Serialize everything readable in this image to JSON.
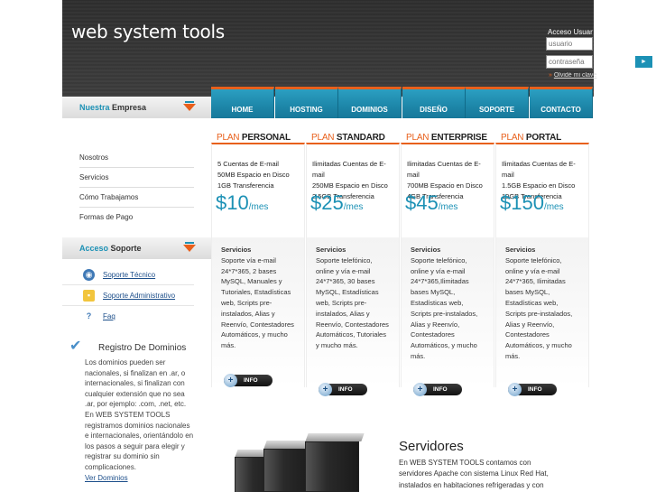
{
  "logo": "web system tools",
  "login": {
    "title": "Acceso Usuarios",
    "user_placeholder": "usuario",
    "pass_placeholder": "contraseña",
    "forgot_arrow": "»",
    "forgot": "Olvidé mi clave",
    "go_icon": "►"
  },
  "nav": [
    "HOME",
    "HOSTING",
    "DOMINIOS",
    "DISEÑO",
    "SOPORTE",
    "CONTACTO"
  ],
  "sidebar": {
    "empresa_title_blue": "Nuestra",
    "empresa_title_rest": " Empresa",
    "empresa_items": [
      "Nosotros",
      "Servicios",
      "Cómo Trabajamos",
      "Formas de Pago"
    ],
    "soporte_title_blue": "Acceso",
    "soporte_title_rest": " Soporte",
    "soporte_items": [
      "Soporte Técnico",
      "Soporte Administrativo",
      "Faq"
    ],
    "registro_title": "Registro De Dominios",
    "registro_body": "Los dominios pueden ser nacionales, si finalizan en .ar, o internacionales, si finalizan con cualquier extensión que no sea .ar, por ejemplo: .com, .net, etc. En WEB SYSTEM TOOLS registramos dominios nacionales e internacionales, orientándolo en los pasos a seguir para elegir y registrar su dominio sin complicaciones.",
    "registro_link": "Ver Dominios"
  },
  "plans": [
    {
      "prefix": "PLAN ",
      "name": "PERSONAL",
      "features": [
        "5 Cuentas de E-mail",
        "50MB Espacio en Disco",
        "1GB Transferencia"
      ],
      "price": "$10",
      "per": "/mes",
      "serv_title": "Servicios",
      "serv_body": "Soporte vía e-mail 24*7*365, 2 bases MySQL, Manuales y Tutoriales, Estadísticas web, Scripts pre-instalados, Alias y Reenvío, Contestadores Automáticos, y mucho más.",
      "info": "INFO"
    },
    {
      "prefix": "PLAN ",
      "name": "STANDARD",
      "features": [
        "Ilimitadas Cuentas de E-mail",
        "250MB Espacio en Disco",
        "2.5GB Transferencia"
      ],
      "price": "$25",
      "per": "/mes",
      "serv_title": "Servicios",
      "serv_body": "Soporte telefónico, online y vía e-mail 24*7*365, 30 bases MySQL, Estadísticas web, Scripts pre-instalados, Alias y Reenvío, Contestadores Automáticos, Tutoriales y mucho más.",
      "info": "INFO"
    },
    {
      "prefix": "PLAN ",
      "name": "ENTERPRISE",
      "features": [
        "Ilimitadas Cuentas de E-mail",
        "700MB Espacio en Disco",
        "4GB Transferencia"
      ],
      "price": "$45",
      "per": "/mes",
      "serv_title": "Servicios",
      "serv_body": "Soporte telefónico, online y vía e-mail 24*7*365,Ilimitadas bases MySQL, Estadísticas web, Scripts pre-instalados, Alias y Reenvío, Contestadores Automáticos, y mucho más.",
      "info": "INFO"
    },
    {
      "prefix": "PLAN ",
      "name": "PORTAL",
      "features": [
        "Ilimitadas Cuentas de E-mail",
        "1.5GB Espacio en Disco",
        "10GB Transferencia"
      ],
      "price": "$150",
      "per": "/mes",
      "serv_title": "Servicios",
      "serv_body": "Soporte telefónico, online y vía e-mail 24*7*365, Ilimitadas bases MySQL, Estadísticas web, Scripts pre-instalados, Alias y Reenvío, Contestadores Automáticos, y mucho más.",
      "info": "INFO"
    }
  ],
  "servidores": {
    "title": "Servidores",
    "body": "En WEB SYSTEM TOOLS contamos con servidores Apache con sistema Linux Red Hat, instalados en habitaciones refrigeradas y con"
  },
  "colors": {
    "accent": "#1c91b5",
    "orange": "#e8601c",
    "header": "#3a3a3a"
  }
}
